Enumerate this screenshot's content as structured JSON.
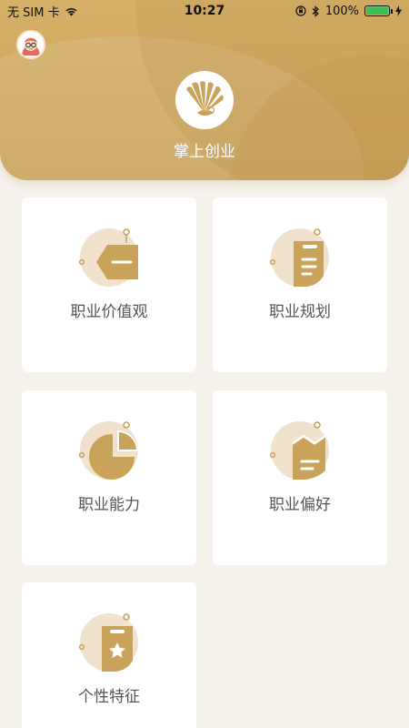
{
  "status_bar": {
    "carrier": "无 SIM 卡",
    "time": "10:27",
    "battery": "100%"
  },
  "header": {
    "title": "掌上创业"
  },
  "menu": [
    {
      "label": "职业价值观",
      "icon": "tag-icon"
    },
    {
      "label": "职业规划",
      "icon": "clipboard-icon"
    },
    {
      "label": "职业能力",
      "icon": "pie-chart-icon"
    },
    {
      "label": "职业偏好",
      "icon": "trend-chart-icon"
    },
    {
      "label": "个性特征",
      "icon": "star-badge-icon"
    }
  ],
  "colors": {
    "gold": "#c9a35a",
    "icon_bg": "#f0e2cc",
    "background": "#f6f2ec"
  }
}
